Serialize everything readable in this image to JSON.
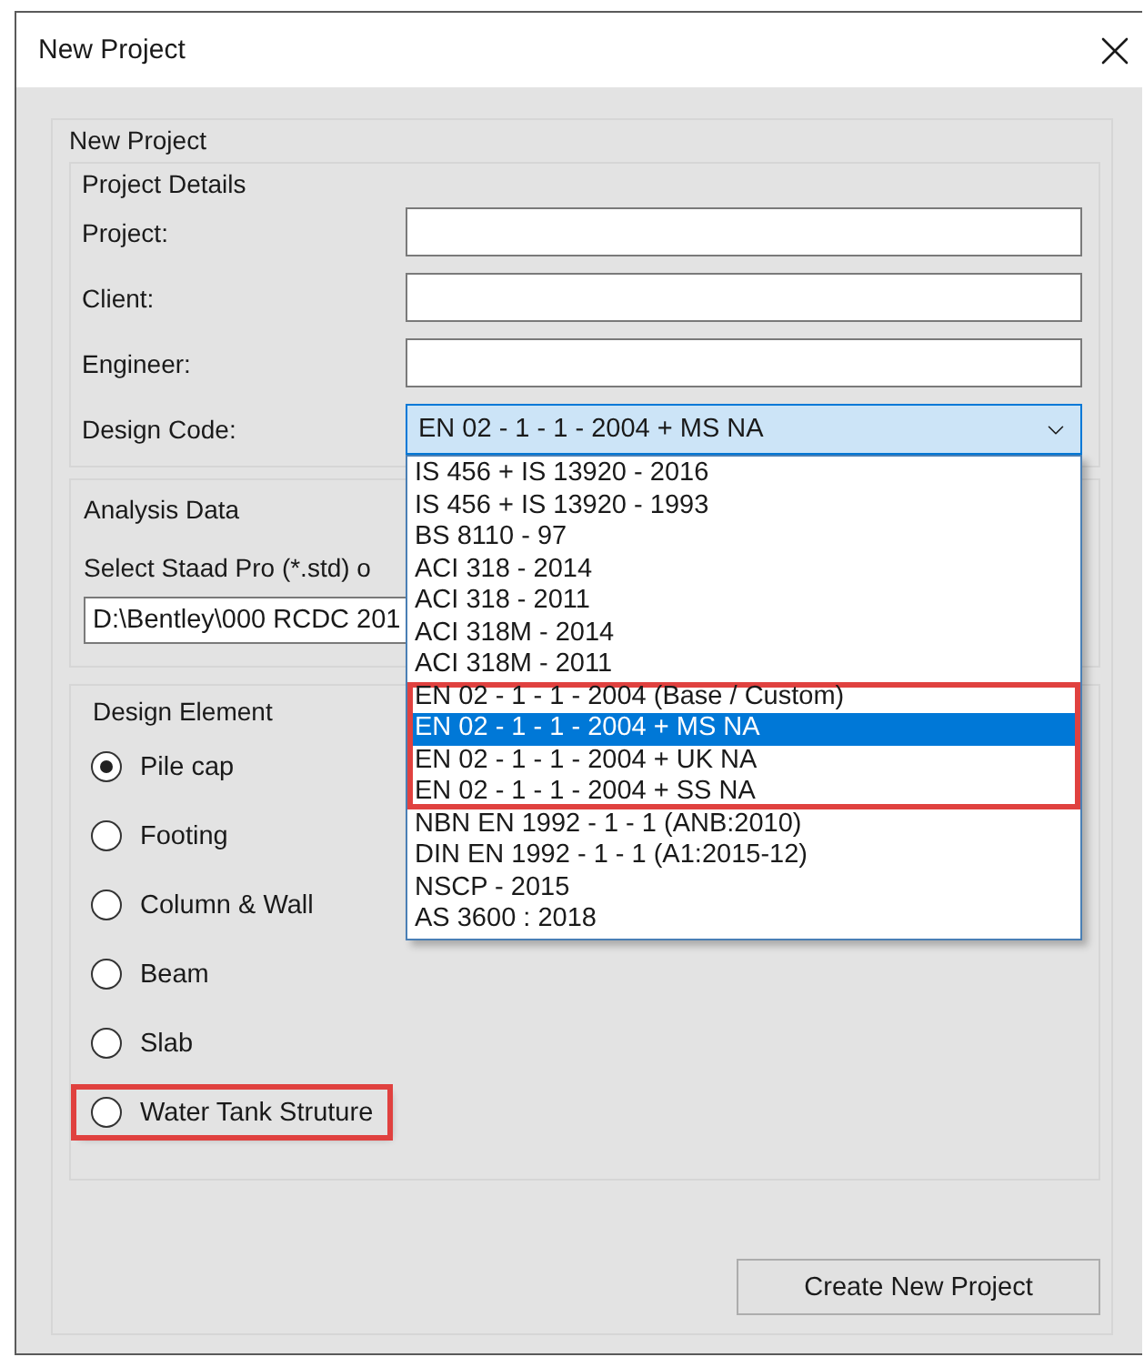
{
  "window": {
    "title": "New Project"
  },
  "group": {
    "title": "New Project"
  },
  "project_details": {
    "title": "Project Details",
    "fields": [
      {
        "label": "Project:"
      },
      {
        "label": "Client:"
      },
      {
        "label": "Engineer:"
      }
    ],
    "design_code": {
      "label": "Design Code:",
      "value": "EN 02 - 1 - 1 - 2004 + MS NA",
      "expanded": true,
      "options": [
        {
          "label": "IS 456 + IS 13920 - 2016",
          "selected": false,
          "highlighted": false
        },
        {
          "label": "IS 456 + IS 13920 - 1993",
          "selected": false,
          "highlighted": false
        },
        {
          "label": "BS 8110 - 97",
          "selected": false,
          "highlighted": false
        },
        {
          "label": "ACI 318 - 2014",
          "selected": false,
          "highlighted": false
        },
        {
          "label": "ACI 318 - 2011",
          "selected": false,
          "highlighted": false
        },
        {
          "label": "ACI 318M - 2014",
          "selected": false,
          "highlighted": false
        },
        {
          "label": "ACI 318M - 2011",
          "selected": false,
          "highlighted": false
        },
        {
          "label": "EN 02 - 1 - 1 - 2004 (Base / Custom)",
          "selected": false,
          "highlighted": true
        },
        {
          "label": "EN 02 - 1 - 1 - 2004 + MS NA",
          "selected": true,
          "highlighted": true
        },
        {
          "label": "EN 02 - 1 - 1 - 2004 + UK NA",
          "selected": false,
          "highlighted": true
        },
        {
          "label": "EN 02 - 1 - 1 - 2004 + SS NA",
          "selected": false,
          "highlighted": true
        },
        {
          "label": "NBN EN 1992 - 1 - 1 (ANB:2010)",
          "selected": false,
          "highlighted": false
        },
        {
          "label": "DIN EN 1992 - 1 - 1 (A1:2015-12)",
          "selected": false,
          "highlighted": false
        },
        {
          "label": "NSCP - 2015",
          "selected": false,
          "highlighted": false
        },
        {
          "label": "AS 3600 : 2018",
          "selected": false,
          "highlighted": false
        }
      ]
    }
  },
  "analysis_data": {
    "title": "Analysis Data",
    "select_label": "Select Staad Pro (*.std) o",
    "path_value": "D:\\Bentley\\000 RCDC 201"
  },
  "design_element": {
    "title": "Design Element",
    "options": [
      {
        "label": "Pile cap",
        "selected": true,
        "highlighted": false
      },
      {
        "label": "Footing",
        "selected": false,
        "highlighted": false
      },
      {
        "label": "Column & Wall",
        "selected": false,
        "highlighted": false
      },
      {
        "label": "Beam",
        "selected": false,
        "highlighted": false
      },
      {
        "label": "Slab",
        "selected": false,
        "highlighted": false
      },
      {
        "label": "Water Tank Struture",
        "selected": false,
        "highlighted": true
      }
    ]
  },
  "buttons": [
    {
      "label": "Create New Project"
    }
  ]
}
